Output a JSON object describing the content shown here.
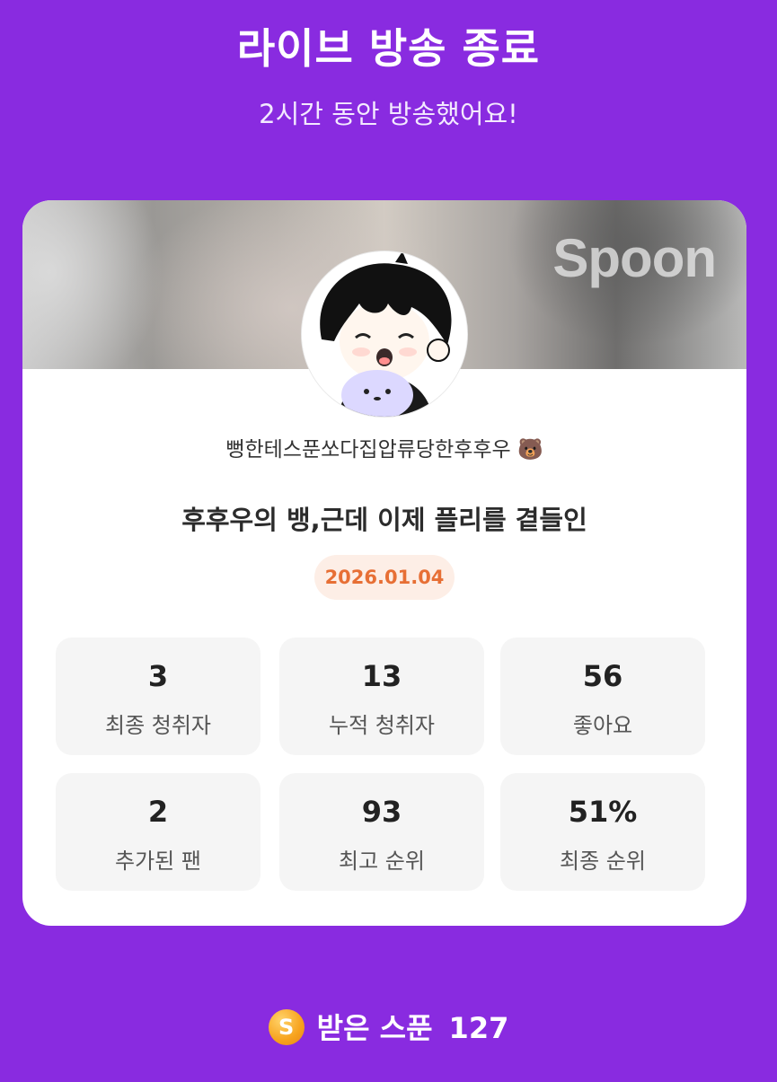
{
  "header": {
    "title": "라이브 방송 종료",
    "subtitle": "2시간 동안 방송했어요!"
  },
  "card": {
    "banner_logo": "Spoon",
    "nickname": "뻥한테스푼쏘다집압류당한후후우 🐻",
    "live_title": "후후우의 뱅,근데 이제 플리를 곁들인",
    "date": "2026.01.04",
    "stats": [
      {
        "value": "3",
        "label": "최종 청취자"
      },
      {
        "value": "13",
        "label": "누적 청취자"
      },
      {
        "value": "56",
        "label": "좋아요"
      },
      {
        "value": "2",
        "label": "추가된 팬"
      },
      {
        "value": "93",
        "label": "최고 순위"
      },
      {
        "value": "51%",
        "label": "최종 순위"
      }
    ]
  },
  "footer": {
    "spoon_icon_letter": "S",
    "spoon_label": "받은 스푼",
    "spoon_count": "127"
  },
  "colors": {
    "background": "#892be0",
    "date_accent": "#e76f35",
    "spoon_coin": "#f7a21d"
  }
}
